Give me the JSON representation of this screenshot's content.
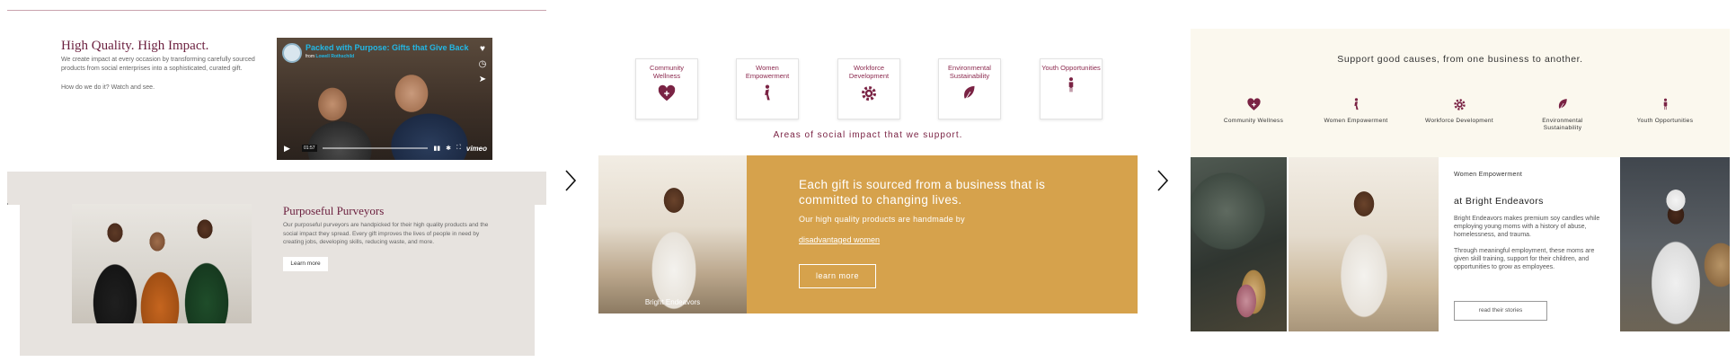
{
  "panel1": {
    "heading": "High Quality. High Impact.",
    "description": "We create impact at every occasion by transforming carefully sourced products from social enterprises into a sophisticated, curated gift.",
    "how": "How do we do it? Watch and see.",
    "video": {
      "title": "Packed with Purpose: Gifts that Give Back",
      "from_prefix": "from",
      "from_name": "Lowell Rothschild",
      "time": "01:57",
      "brand": "vimeo"
    },
    "purveyors_heading": "Purposeful Purveyors",
    "purveyors_text": "Our purposeful purveyors are handpicked for their high quality products and the social impact they spread. Every gift improves the lives of people in need by creating jobs, developing skills, reducing waste, and more.",
    "learn_more": "Learn more"
  },
  "panel2": {
    "categories": [
      {
        "label": "Community Wellness",
        "icon": "heart-plus-icon"
      },
      {
        "label": "Women Empowerment",
        "icon": "woman-figure-icon"
      },
      {
        "label": "Workforce Development",
        "icon": "gear-icon"
      },
      {
        "label": "Environmental Sustainability",
        "icon": "leaf-icon"
      },
      {
        "label": "Youth Opportunities",
        "icon": "child-figure-icon"
      }
    ],
    "caption": "Areas of social impact that we support.",
    "photo_label": "Bright Endeavors",
    "headline": "Each gift is sourced from a business that is committed to changing lives.",
    "sub": "Our high quality products are handmade by",
    "link": "disadvantaged women",
    "button": "learn more"
  },
  "panel3": {
    "heading": "Support good causes, from one business to another.",
    "categories": [
      {
        "label": "Community Wellness",
        "icon": "heart-plus-icon"
      },
      {
        "label": "Women Empowerment",
        "icon": "woman-figure-icon"
      },
      {
        "label": "Workforce Development",
        "icon": "gear-icon"
      },
      {
        "label": "Environmental Sustainability",
        "icon": "leaf-icon"
      },
      {
        "label": "Youth Opportunities",
        "icon": "child-figure-icon"
      }
    ],
    "tag": "Women Empowerment",
    "title": "at Bright Endeavors",
    "p1": "Bright Endeavors makes premium soy candles while employing young moms with a history of abuse, homelessness, and trauma.",
    "p2": "Through meaningful employment, these moms are given skill training, support for their children, and opportunities to grow as employees.",
    "button": "read their stories"
  },
  "colors": {
    "brand_maroon": "#6b1f3e",
    "icon_maroon": "#7a2344",
    "gold": "#d6a24c",
    "cream": "#fbf8ee",
    "panel_grey": "#e7e3df",
    "vimeo_blue": "#22b8e6"
  }
}
